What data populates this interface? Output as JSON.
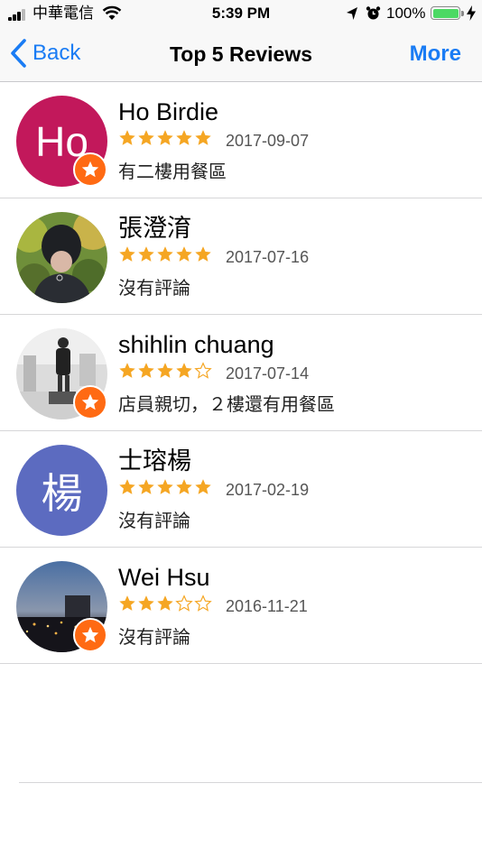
{
  "status_bar": {
    "carrier": "中華電信",
    "time": "5:39 PM",
    "battery": "100%"
  },
  "nav": {
    "back_label": "Back",
    "title": "Top 5 Reviews",
    "more_label": "More"
  },
  "colors": {
    "accent": "#1a7cf4",
    "star": "#f5a623",
    "badge": "#ff6a13"
  },
  "reviews": [
    {
      "name": "Ho Birdie",
      "rating": 5,
      "date": "2017-09-07",
      "text": "有二樓用餐區",
      "avatar_type": "letter",
      "avatar_text": "Ho",
      "avatar_color": "#c2185b",
      "badge": true
    },
    {
      "name": "張澄淯",
      "rating": 5,
      "date": "2017-07-16",
      "text": "沒有評論",
      "avatar_type": "photo",
      "avatar_text": "",
      "avatar_color": "",
      "badge": false
    },
    {
      "name": "shihlin chuang",
      "rating": 4,
      "date": "2017-07-14",
      "text": "店員親切，２樓還有用餐區",
      "avatar_type": "photo",
      "avatar_text": "",
      "avatar_color": "",
      "badge": true
    },
    {
      "name": "士瑢楊",
      "rating": 5,
      "date": "2017-02-19",
      "text": "沒有評論",
      "avatar_type": "letter",
      "avatar_text": "楊",
      "avatar_color": "#5c6bc0",
      "badge": false
    },
    {
      "name": "Wei Hsu",
      "rating": 3,
      "date": "2016-11-21",
      "text": "沒有評論",
      "avatar_type": "photo",
      "avatar_text": "",
      "avatar_color": "",
      "badge": true
    }
  ]
}
